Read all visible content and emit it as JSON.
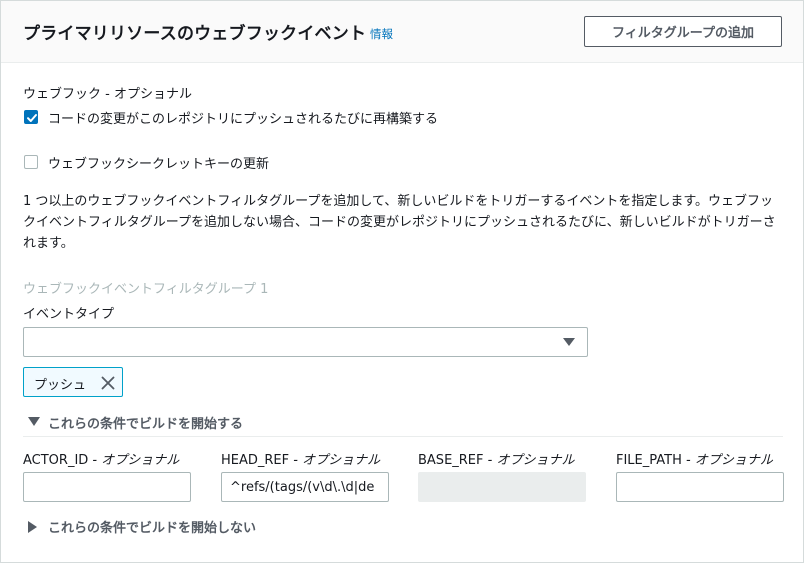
{
  "header": {
    "title": "プライマリリソースのウェブフックイベント",
    "info_link": "情報",
    "add_group_button": "フィルタグループの追加"
  },
  "webhook": {
    "label": "ウェブフック - オプショナル",
    "rebuild_checkbox": {
      "label": "コードの変更がこのレポジトリにプッシュされるたびに再構築する",
      "checked": true
    },
    "secret_checkbox": {
      "label": "ウェブフックシークレットキーの更新",
      "checked": false
    }
  },
  "description": "1 つ以上のウェブフックイベントフィルタグループを追加して、新しいビルドをトリガーするイベントを指定します。ウェブフックイベントフィルタグループを追加しない場合、コードの変更がレポジトリにプッシュされるたびに、新しいビルドがトリガーされます。",
  "filter_group": {
    "title": "ウェブフックイベントフィルタグループ 1",
    "event_type_label": "イベントタイプ",
    "event_type_value": "",
    "selected_token": "プッシュ",
    "start_conditions": {
      "label": "これらの条件でビルドを開始する",
      "expanded": true,
      "fields": [
        {
          "name": "ACTOR_ID",
          "optional": " - オプショナル",
          "value": "",
          "disabled": false
        },
        {
          "name": "HEAD_REF",
          "optional": " - オプショナル",
          "value": "^refs/(tags/(v\\d\\.\\d|de",
          "disabled": false
        },
        {
          "name": "BASE_REF",
          "optional": " - オプショナル",
          "value": "",
          "disabled": true
        },
        {
          "name": "FILE_PATH",
          "optional": " - オプショナル",
          "value": "",
          "disabled": false
        }
      ]
    },
    "stop_conditions": {
      "label": "これらの条件でビルドを開始しない",
      "expanded": false
    }
  },
  "colors": {
    "link": "#0073bb",
    "checkbox_checked": "#0073bb",
    "token_border": "#00a1c9",
    "token_bg": "#f1faff",
    "muted_text": "#aab7b8"
  }
}
